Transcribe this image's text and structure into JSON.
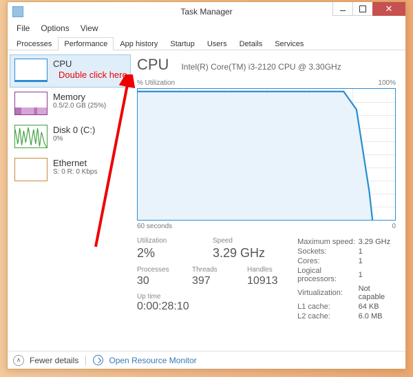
{
  "window": {
    "title": "Task Manager"
  },
  "menu": {
    "file": "File",
    "options": "Options",
    "view": "View"
  },
  "tabs": {
    "processes": "Processes",
    "performance": "Performance",
    "app_history": "App history",
    "startup": "Startup",
    "users": "Users",
    "details": "Details",
    "services": "Services"
  },
  "sidebar": {
    "items": [
      {
        "name": "CPU",
        "sub": ""
      },
      {
        "name": "Memory",
        "sub": "0.5/2.0 GB (25%)"
      },
      {
        "name": "Disk 0 (C:)",
        "sub": "0%"
      },
      {
        "name": "Ethernet",
        "sub": "S: 0 R: 0 Kbps"
      }
    ]
  },
  "main": {
    "title": "CPU",
    "processor": "Intel(R) Core(TM) i3-2120 CPU @ 3.30GHz",
    "chart_top_left": "% Utilization",
    "chart_top_right": "100%",
    "chart_bottom_left": "60 seconds",
    "chart_bottom_right": "0",
    "stats": {
      "utilization_label": "Utilization",
      "utilization": "2%",
      "speed_label": "Speed",
      "speed": "3.29 GHz",
      "processes_label": "Processes",
      "processes": "30",
      "threads_label": "Threads",
      "threads": "397",
      "handles_label": "Handles",
      "handles": "10913",
      "uptime_label": "Up time",
      "uptime": "0:00:28:10"
    },
    "spec": {
      "max_speed_l": "Maximum speed:",
      "max_speed": "3.29 GHz",
      "sockets_l": "Sockets:",
      "sockets": "1",
      "cores_l": "Cores:",
      "cores": "1",
      "logical_l": "Logical processors:",
      "logical": "1",
      "virt_l": "Virtualization:",
      "virt": "Not capable",
      "l1_l": "L1 cache:",
      "l1": "64 KB",
      "l2_l": "L2 cache:",
      "l2": "6.0 MB"
    }
  },
  "footer": {
    "fewer": "Fewer details",
    "resmon": "Open Resource Monitor"
  },
  "annotation": {
    "text": "Double click here"
  },
  "chart_data": {
    "type": "line",
    "title": "% Utilization",
    "xlabel": "60 seconds",
    "ylabel": "% Utilization",
    "ylim": [
      0,
      100
    ],
    "x_seconds_ago": [
      60,
      57,
      54,
      51,
      48,
      45,
      42,
      39,
      36,
      33,
      30,
      27,
      24,
      21,
      18,
      15,
      12,
      9,
      6,
      3,
      0
    ],
    "values": [
      99,
      99,
      99,
      99,
      99,
      99,
      99,
      99,
      99,
      99,
      99,
      99,
      99,
      99,
      99,
      99,
      99,
      92,
      60,
      15,
      2
    ]
  }
}
